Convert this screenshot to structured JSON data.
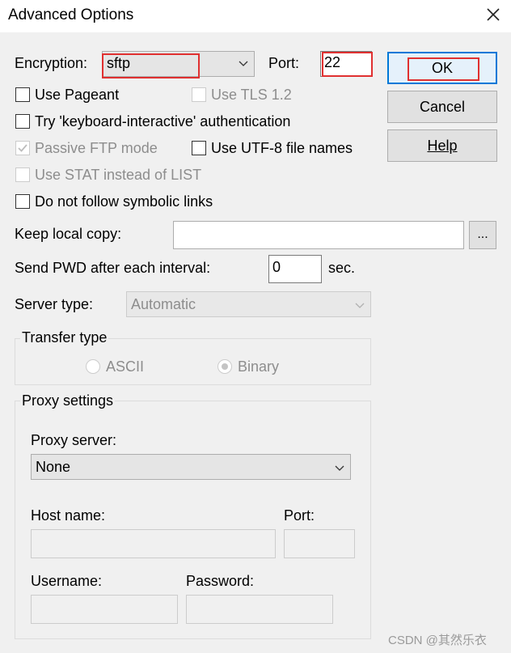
{
  "window": {
    "title": "Advanced Options",
    "close_icon": "close-icon"
  },
  "encryption": {
    "label": "Encryption:",
    "value": "sftp",
    "port_label": "Port:",
    "port_value": "22"
  },
  "buttons": {
    "ok": "OK",
    "cancel": "Cancel",
    "help": "Help"
  },
  "options": {
    "use_pageant": "Use Pageant",
    "use_tls": "Use TLS 1.2",
    "keyboard_interactive": "Try 'keyboard-interactive' authentication",
    "passive_ftp": "Passive FTP mode",
    "utf8": "Use UTF-8 file names",
    "use_stat": "Use STAT instead of LIST",
    "no_symlinks": "Do not follow symbolic links"
  },
  "keep_local": {
    "label": "Keep local copy:",
    "value": "",
    "browse": "..."
  },
  "send_pwd": {
    "label": "Send PWD after each interval:",
    "value": "0",
    "unit": "sec."
  },
  "server_type": {
    "label": "Server type:",
    "value": "Automatic"
  },
  "transfer": {
    "title": "Transfer type",
    "ascii": "ASCII",
    "binary": "Binary"
  },
  "proxy": {
    "title": "Proxy settings",
    "server_label": "Proxy server:",
    "server_value": "None",
    "host_label": "Host name:",
    "port_label": "Port:",
    "user_label": "Username:",
    "password_label": "Password:"
  },
  "watermark": "CSDN @其然乐衣"
}
